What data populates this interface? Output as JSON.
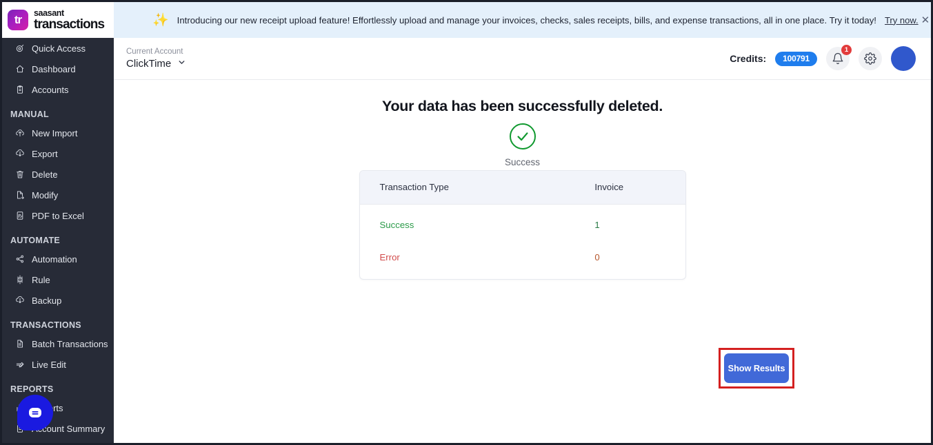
{
  "brand": {
    "mark": "tr",
    "line1": "saasant",
    "line2": "transactions"
  },
  "banner": {
    "icon": "sparkle-icon",
    "text": "Introducing our new receipt upload feature! Effortlessly upload and manage your invoices, checks, sales receipts, bills, and expense transactions, all in one place. Try it today!",
    "link": "Try now.",
    "close": "✕"
  },
  "header": {
    "account_label": "Current Account",
    "account_name": "ClickTime",
    "caret": "⌄",
    "credits_label": "Credits:",
    "credits_value": "100791",
    "notification_count": "1"
  },
  "sidebar": {
    "groups": [
      {
        "title": null,
        "items": [
          {
            "label": "Quick Access",
            "icon": "target-icon"
          },
          {
            "label": "Dashboard",
            "icon": "home-icon"
          },
          {
            "label": "Accounts",
            "icon": "clipboard-icon"
          }
        ]
      },
      {
        "title": "MANUAL",
        "items": [
          {
            "label": "New Import",
            "icon": "upload-cloud-icon"
          },
          {
            "label": "Export",
            "icon": "download-cloud-icon"
          },
          {
            "label": "Delete",
            "icon": "trash-icon"
          },
          {
            "label": "Modify",
            "icon": "file-edit-icon"
          },
          {
            "label": "PDF to Excel",
            "icon": "pdf-file-icon"
          }
        ]
      },
      {
        "title": "AUTOMATE",
        "items": [
          {
            "label": "Automation",
            "icon": "share-nodes-icon"
          },
          {
            "label": "Rule",
            "icon": "rule-icon"
          },
          {
            "label": "Backup",
            "icon": "download-cloud-icon"
          }
        ]
      },
      {
        "title": "TRANSACTIONS",
        "items": [
          {
            "label": "Batch Transactions",
            "icon": "document-icon"
          },
          {
            "label": "Live Edit",
            "icon": "pencil-line-icon"
          }
        ]
      },
      {
        "title": "REPORTS",
        "items": [
          {
            "label": "Reports",
            "icon": "chart-icon"
          },
          {
            "label": "Account Summary",
            "icon": "clipboard-icon"
          }
        ]
      }
    ]
  },
  "main": {
    "title": "Your data has been successfully deleted.",
    "status": "Success",
    "status_icon": "check-circle-icon",
    "table": {
      "headers": [
        "Transaction Type",
        "Invoice"
      ],
      "rows": [
        {
          "type": "Success",
          "value": "1"
        },
        {
          "type": "Error",
          "value": "0"
        }
      ]
    },
    "show_results_button": "Show Results"
  },
  "chat": {
    "icon": "chat-bubble-icon"
  },
  "colors": {
    "sidebar_bg": "#272b37",
    "banner_bg": "#e4f0fb",
    "accent_blue": "#1f7ded",
    "button_blue": "#4169d8",
    "highlight_red": "#d42020",
    "success_green": "#2a9a48",
    "error_red": "#d14a4a",
    "table_header_bg": "#f2f4fa"
  }
}
